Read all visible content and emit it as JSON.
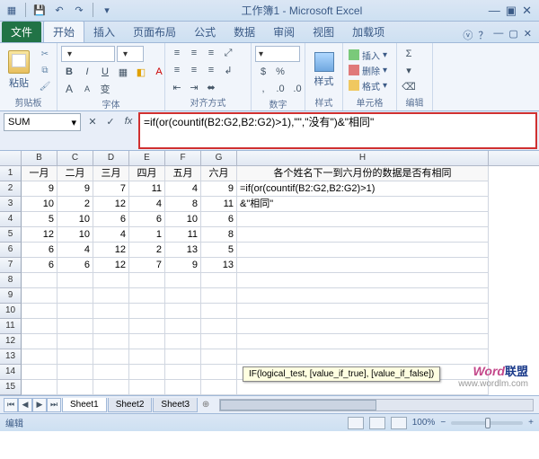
{
  "title": "工作簿1 - Microsoft Excel",
  "tabs": {
    "file": "文件",
    "items": [
      "开始",
      "插入",
      "页面布局",
      "公式",
      "数据",
      "审阅",
      "视图",
      "加载项"
    ],
    "active": "开始"
  },
  "ribbon": {
    "clipboard": {
      "label": "剪贴板",
      "paste": "粘贴"
    },
    "font": {
      "label": "字体",
      "name": "",
      "size": "",
      "grow": "A",
      "shrink": "A"
    },
    "align": {
      "label": "对齐方式"
    },
    "number": {
      "label": "数字"
    },
    "styles": {
      "label": "样式",
      "button": "样式"
    },
    "cells": {
      "label": "单元格",
      "insert": "插入",
      "delete": "删除",
      "format": "格式"
    },
    "editing": {
      "label": "编辑",
      "sum": "Σ",
      "fill": "▾",
      "clear": "⌫"
    }
  },
  "namebox": "SUM",
  "formula_bar": "=if(or(countif(B2:G2,B2:G2)>1),\"\",\"没有\")&\"相同\"",
  "columns": [
    "B",
    "C",
    "D",
    "E",
    "F",
    "G",
    "H"
  ],
  "header_row": [
    "一月",
    "二月",
    "三月",
    "四月",
    "五月",
    "六月",
    "各个姓名下一到六月份的数据是否有相同"
  ],
  "data_rows": [
    {
      "r": 2,
      "v": [
        9,
        9,
        7,
        11,
        4,
        9
      ],
      "h": "=if(or(countif(B2:G2,B2:G2)>1)"
    },
    {
      "r": 3,
      "v": [
        10,
        2,
        12,
        4,
        8,
        11
      ],
      "h": "&\"相同\""
    },
    {
      "r": 4,
      "v": [
        5,
        10,
        6,
        6,
        10,
        6
      ],
      "h": ""
    },
    {
      "r": 5,
      "v": [
        12,
        10,
        4,
        1,
        11,
        8
      ],
      "h": ""
    },
    {
      "r": 6,
      "v": [
        6,
        4,
        12,
        2,
        13,
        5
      ],
      "h": ""
    },
    {
      "r": 7,
      "v": [
        6,
        6,
        12,
        7,
        9,
        13
      ],
      "h": ""
    }
  ],
  "empty_rows": [
    8,
    9,
    10,
    11,
    12,
    13,
    14,
    15
  ],
  "tooltip": "IF(logical_test, [value_if_true], [value_if_false])",
  "watermark": {
    "brand": "Word",
    "cn": "联盟",
    "url": "www.wordlm.com"
  },
  "sheets": [
    "Sheet1",
    "Sheet2",
    "Sheet3"
  ],
  "status": {
    "mode": "编辑",
    "zoom": "100%"
  },
  "chart_data": {
    "type": "table",
    "columns": [
      "一月",
      "二月",
      "三月",
      "四月",
      "五月",
      "六月"
    ],
    "rows": [
      [
        9,
        9,
        7,
        11,
        4,
        9
      ],
      [
        10,
        2,
        12,
        4,
        8,
        11
      ],
      [
        5,
        10,
        6,
        6,
        10,
        6
      ],
      [
        12,
        10,
        4,
        1,
        11,
        8
      ],
      [
        6,
        4,
        12,
        2,
        13,
        5
      ],
      [
        6,
        6,
        12,
        7,
        9,
        13
      ]
    ]
  }
}
